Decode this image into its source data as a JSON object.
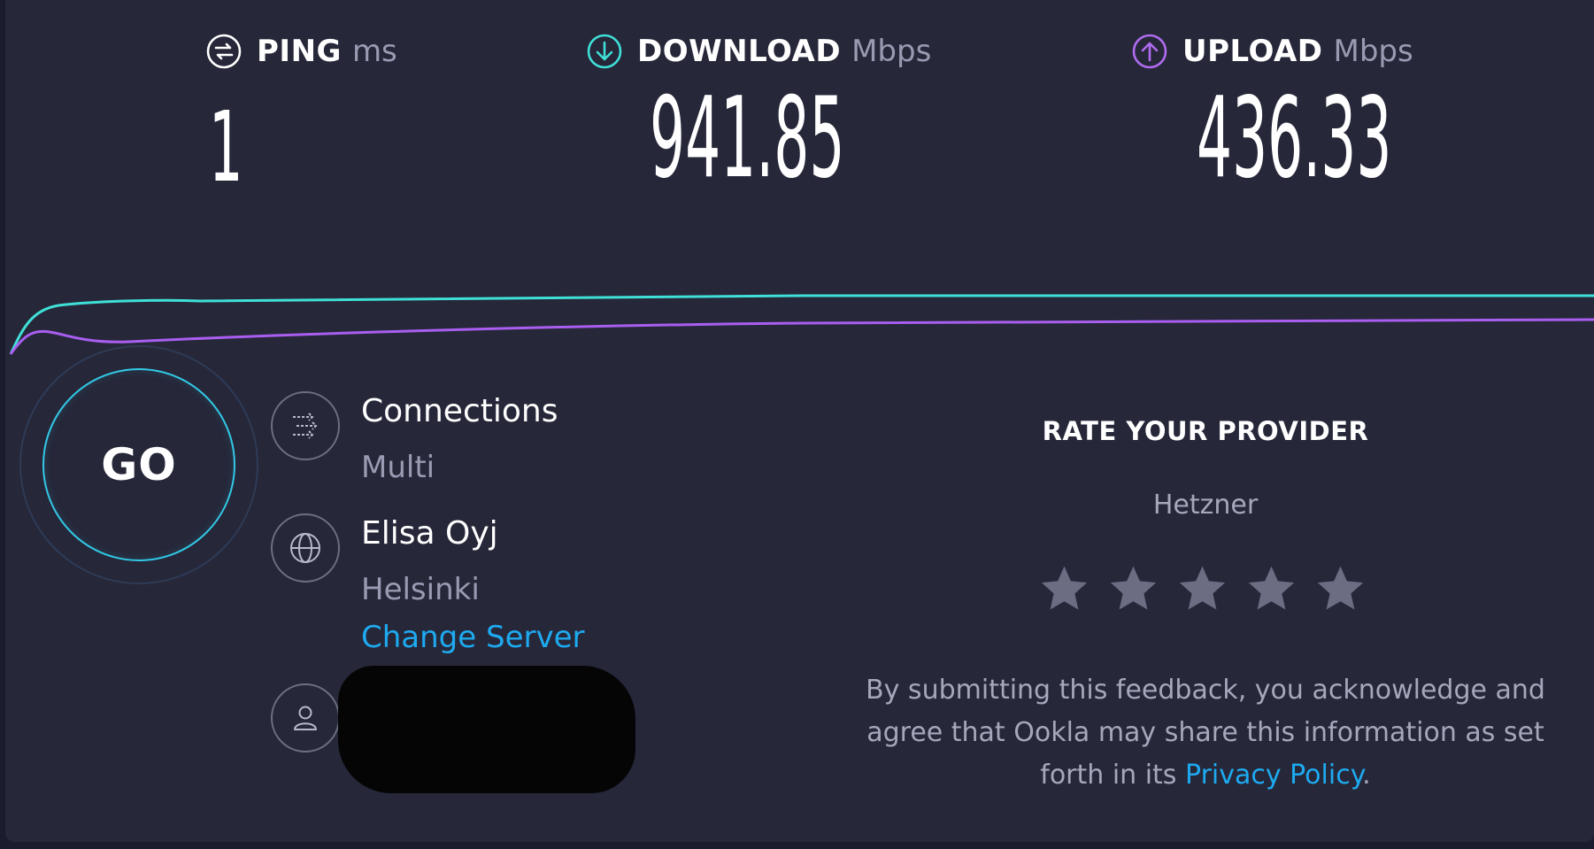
{
  "metrics": {
    "ping": {
      "label": "PING",
      "unit": "ms",
      "value": "1",
      "color": "#ffffff"
    },
    "download": {
      "label": "DOWNLOAD",
      "unit": "Mbps",
      "value": "941.85",
      "color": "#3fe0d8"
    },
    "upload": {
      "label": "UPLOAD",
      "unit": "Mbps",
      "value": "436.33",
      "color": "#b06cf0"
    }
  },
  "go_button": {
    "label": "GO"
  },
  "connections": {
    "title": "Connections",
    "value": "Multi"
  },
  "server": {
    "name": "Elisa Oyj",
    "location": "Helsinki",
    "change_label": "Change Server"
  },
  "rating": {
    "title": "RATE YOUR PROVIDER",
    "provider": "Hetzner",
    "stars": 5,
    "feedback_text": "By submitting this feedback, you acknowledge and agree that Ookla may share this information as set forth in its",
    "privacy_link": "Privacy Policy",
    "period": "."
  },
  "colors": {
    "background": "#262739",
    "download_line": "#3fe0d8",
    "upload_line": "#a95ef0",
    "link": "#1eaaf0",
    "star": "#6c6d83"
  }
}
